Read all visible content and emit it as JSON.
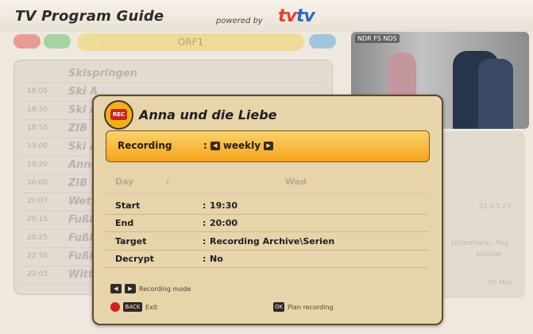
{
  "header": {
    "title": "TV Program Guide",
    "powered_by": "powered by",
    "brand_left": "tv",
    "brand_right": "tv"
  },
  "color_buttons": {
    "channel_name": "ORF1"
  },
  "list": [
    {
      "time": "",
      "title": "Skispringen"
    },
    {
      "time": "18:05",
      "title": "Ski A"
    },
    {
      "time": "18:30",
      "title": "Ski A"
    },
    {
      "time": "18:55",
      "title": "ZIB F"
    },
    {
      "time": "19:00",
      "title": "Ski A"
    },
    {
      "time": "19:20",
      "title": "Anna"
    },
    {
      "time": "20:00",
      "title": "ZIB 2"
    },
    {
      "time": "20:07",
      "title": "Wett"
    },
    {
      "time": "20:15",
      "title": "Fußb"
    },
    {
      "time": "20:25",
      "title": "Fußb"
    },
    {
      "time": "22:35",
      "title": "Fußb"
    },
    {
      "time": "22:05",
      "title": "Witt"
    }
  ],
  "video": {
    "channel": "NDR FS NDS"
  },
  "right_panel": {
    "text1": "21:03:23",
    "text2": "Jattermann, Roy",
    "text3": "Lustige",
    "text4": "90 Min"
  },
  "popup": {
    "title": "Anna und die Liebe",
    "recording_label": "Recording",
    "recording_value": "weekly",
    "day_label": "Day",
    "day_value": "Wed",
    "start_label": "Start",
    "start_value": "19:30",
    "end_label": "End",
    "end_value": "20:00",
    "target_label": "Target",
    "target_value": "Recording Archive\\Serien",
    "decrypt_label": "Decrypt",
    "decrypt_value": "No",
    "help_mode": "Recording mode",
    "help_exit": "Exit",
    "help_plan": "Plan recording",
    "rec_icon_text": "REC",
    "key_ok": "OK",
    "key_back": "BACK"
  }
}
